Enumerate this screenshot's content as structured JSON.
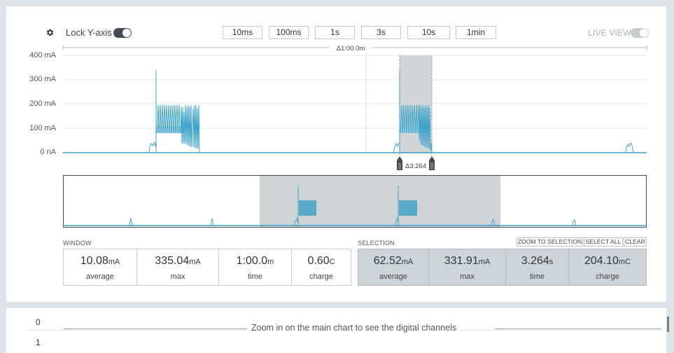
{
  "toolbar": {
    "lock_y_label": "Lock Y-axis",
    "lock_y_on": true,
    "window_buttons": [
      "10ms",
      "100ms",
      "1s",
      "3s",
      "10s",
      "1min"
    ],
    "live_view_label": "LIVE VIEW",
    "live_view_on": false
  },
  "main_chart": {
    "y_ticks": [
      "400 mA",
      "300 mA",
      "200 mA",
      "100 mA",
      "0 nA"
    ],
    "window_delta_label": "Δ1:00.0m",
    "selection_delta_label": "Δ3.264"
  },
  "window_stats": {
    "title": "WINDOW",
    "items": [
      {
        "value": "10.08",
        "unit": "mA",
        "label": "average"
      },
      {
        "value": "335.04",
        "unit": "mA",
        "label": "max"
      },
      {
        "value": "1:00.0",
        "unit": "m",
        "label": "time"
      },
      {
        "value": "0.60",
        "unit": "C",
        "label": "charge"
      }
    ]
  },
  "selection_stats": {
    "title": "SELECTION",
    "buttons": [
      "ZOOM TO SELECTION",
      "SELECT ALL",
      "CLEAR"
    ],
    "items": [
      {
        "value": "62.52",
        "unit": "mA",
        "label": "average"
      },
      {
        "value": "331.91",
        "unit": "mA",
        "label": "max"
      },
      {
        "value": "3.264",
        "unit": "s",
        "label": "time"
      },
      {
        "value": "204.10",
        "unit": "mC",
        "label": "charge"
      }
    ]
  },
  "digital": {
    "channels": [
      "0",
      "1"
    ],
    "message": "Zoom in on the main chart to see the digital channels"
  },
  "colors": {
    "trace": "#3ba3c9",
    "selection_fill": "#d2d6d9",
    "selection_stats_bg": "#cfd4d8",
    "toggle_on": "#444b52",
    "toggle_off": "#c9cdd1"
  }
}
